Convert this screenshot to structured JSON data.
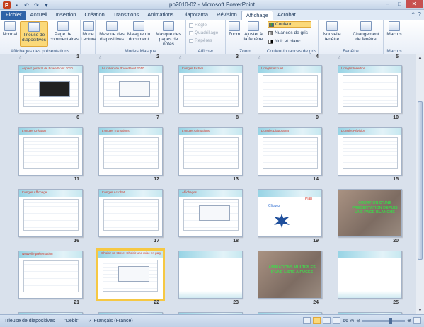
{
  "window": {
    "title": "pp2010-02 - Microsoft PowerPoint"
  },
  "tabs": [
    {
      "label": "Fichier"
    },
    {
      "label": "Accueil"
    },
    {
      "label": "Insertion"
    },
    {
      "label": "Création"
    },
    {
      "label": "Transitions"
    },
    {
      "label": "Animations"
    },
    {
      "label": "Diaporama"
    },
    {
      "label": "Révision"
    },
    {
      "label": "Affichage"
    },
    {
      "label": "Acrobat"
    }
  ],
  "ribbon": {
    "groups": {
      "presentation_views": "Affichages des présentations",
      "master_views": "Modes Masque",
      "show": "Afficher",
      "zoom": "Zoom",
      "color": "Couleur/nuances de gris",
      "window": "Fenêtre",
      "macros": "Macros"
    },
    "buttons": {
      "normal": "Normal",
      "sorter": "Trieuse de diapositives",
      "notes_page": "Page de commentaires",
      "reading": "Mode Lecture",
      "slide_master": "Masque des diapositives",
      "handout_master": "Masque du document",
      "notes_master": "Masque des pages de notes",
      "zoom": "Zoom",
      "fit": "Ajuster à la fenêtre",
      "new_window": "Nouvelle fenêtre",
      "switch_windows": "Changement de fenêtre",
      "macros": "Macros"
    },
    "checks": {
      "ruler": "Règle",
      "grid": "Quadrillage",
      "guides": "Repères"
    },
    "colors": {
      "color": "Couleur",
      "grayscale": "Nuances de gris",
      "bw": "Noir et blanc"
    }
  },
  "slides": [
    {
      "num": "6",
      "title": "Aspect général de PowerPoint 2010"
    },
    {
      "num": "7",
      "title": "Le ruban de PowerPoint 2010"
    },
    {
      "num": "8",
      "title": "L'onglet Fichier"
    },
    {
      "num": "9",
      "title": "L'onglet Accueil"
    },
    {
      "num": "10",
      "title": "L'onglet Insertion"
    },
    {
      "num": "11",
      "title": "L'onglet Création"
    },
    {
      "num": "12",
      "title": "L'onglet Transitions"
    },
    {
      "num": "13",
      "title": "L'onglet Animations"
    },
    {
      "num": "14",
      "title": "L'onglet Diaporama"
    },
    {
      "num": "15",
      "title": "L'onglet Révision"
    },
    {
      "num": "16",
      "title": "L'onglet Affichage"
    },
    {
      "num": "17",
      "title": "L'onglet Acrobat"
    },
    {
      "num": "18",
      "title": "Affichages"
    },
    {
      "num": "19",
      "title": "",
      "a": "Cliquez",
      "b": "Plan"
    },
    {
      "num": "20",
      "title": "",
      "photo": "CREATION D'UNE PRESENTATION DEPUIS UNE PAGE BLANCHE"
    },
    {
      "num": "21",
      "title": "Nouvelle présentation"
    },
    {
      "num": "22",
      "title": "Choisir un titre et Choisir une mise en page"
    },
    {
      "num": "23",
      "title": ""
    },
    {
      "num": "24",
      "title": "",
      "photo": "ANIMATIONS MULTIPLES D'UNE LISTE A PUCES"
    },
    {
      "num": "25",
      "title": ""
    }
  ],
  "top_numbers": [
    "1",
    "2",
    "3",
    "4",
    "5"
  ],
  "status": {
    "view": "Trieuse de diapositives",
    "theme": "\"Débit\"",
    "lang": "Français (France)",
    "zoom": "66 %"
  },
  "colors": {
    "accent": "#f6c843",
    "file_tab": "#2f63a7"
  }
}
